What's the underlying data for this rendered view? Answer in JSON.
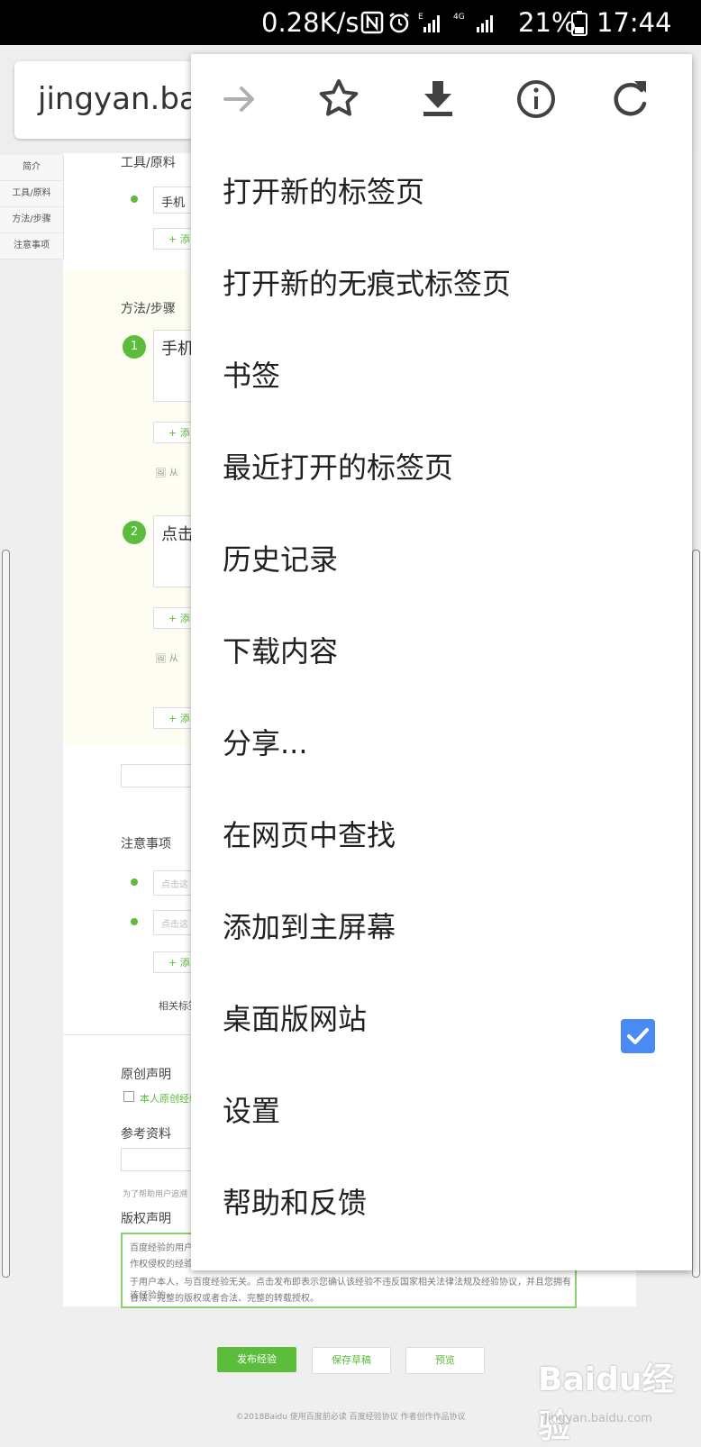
{
  "status_bar": {
    "speed": "0.28K/s",
    "battery": "21%",
    "time": "17:44"
  },
  "address_bar": {
    "url": "jingyan.baidu.com"
  },
  "page": {
    "sidebar": [
      "简介",
      "工具/原料",
      "方法/步骤",
      "注意事项"
    ],
    "tools_heading": "工具/原料",
    "tool_item": "手机",
    "add_label": "+ 添",
    "steps_heading": "方法/步骤",
    "step1_num": "1",
    "step1_text": "手机",
    "step2_num": "2",
    "step2_text": "点击",
    "from_label": "从",
    "notes_heading": "注意事项",
    "note_placeholder": "点击这",
    "related_tags": "相关标签",
    "original_heading": "原创声明",
    "original_check": "本人原创经验",
    "ref_heading": "参考资料",
    "ref_note": "为了帮助用户追溯",
    "copyright_heading": "版权声明",
    "copyright_line1": "百度经验的用户",
    "copyright_line2": "作权侵权的经验",
    "copyright_line3": "于用户本人，与百度经验无关。点击发布即表示您确认该经验不违反国家相关法律法规及经验协议，并且您拥有该经验的",
    "copyright_line4": "合法、完整的版权或者合法、完整的转载授权。",
    "publish": "发布经验",
    "save_draft": "保存草稿",
    "preview": "预览",
    "footer": "©2018Baidu  使用百度前必读  百度经验协议  作者创作作品协议",
    "watermark": "Baidu经验",
    "watermark_url": "jingyan.baidu.com"
  },
  "menu": {
    "items": [
      "打开新的标签页",
      "打开新的无痕式标签页",
      "书签",
      "最近打开的标签页",
      "历史记录",
      "下载内容",
      "分享...",
      "在网页中查找",
      "添加到主屏幕",
      "桌面版网站",
      "设置",
      "帮助和反馈"
    ],
    "desktop_site_checked": true
  },
  "colors": {
    "accent": "#5bbd3b",
    "checkbox": "#4a8af4",
    "disabled_arrow": "#b0b0b0",
    "icon": "#424242"
  }
}
